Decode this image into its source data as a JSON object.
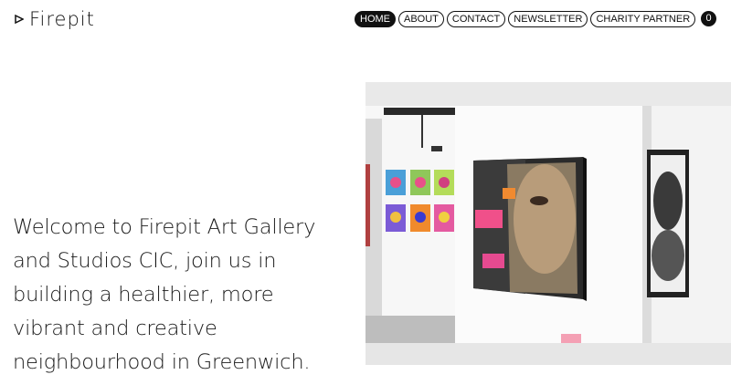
{
  "brand": {
    "name": "Firepit"
  },
  "nav": {
    "items": [
      {
        "label": "HOME",
        "active": true
      },
      {
        "label": "ABOUT",
        "active": false
      },
      {
        "label": "CONTACT",
        "active": false
      },
      {
        "label": "NEWSLETTER",
        "active": false
      },
      {
        "label": "CHARITY PARTNER",
        "active": false
      }
    ]
  },
  "cart": {
    "count": "0"
  },
  "hero": {
    "text": "Welcome to Firepit Art Gallery and Studios CIC, join us in building a healthier, more vibrant and creative neighbourhood in Greenwich.",
    "image_subject": "gallery interior with portrait paintings on white walls"
  },
  "colors": {
    "text": "#111111",
    "background": "#ffffff",
    "nav_active_bg": "#111111"
  }
}
